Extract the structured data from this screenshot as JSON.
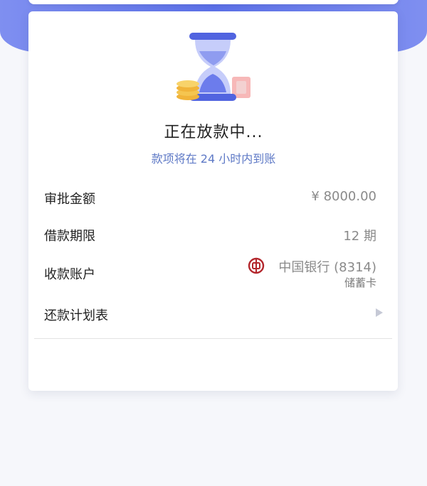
{
  "status": {
    "title": "正在放款中...",
    "subtitle": "款项将在 24 小时内到账"
  },
  "details": {
    "approved_amount": {
      "label": "审批金额",
      "value": "¥ 8000.00"
    },
    "loan_term": {
      "label": "借款期限",
      "value": "12 期"
    },
    "receiving_account": {
      "label": "收款账户",
      "bank": "中国银行 (8314)",
      "card_type": "储蓄卡"
    },
    "repayment_plan": {
      "label": "还款计划表"
    }
  },
  "colors": {
    "accent": "#5d72ea",
    "subtitle": "#5e79c6",
    "bank_red": "#b3262c"
  },
  "icons": {
    "status": "hourglass-icon",
    "bank": "bank-of-china-logo-icon",
    "arrow": "chevron-right-icon"
  }
}
